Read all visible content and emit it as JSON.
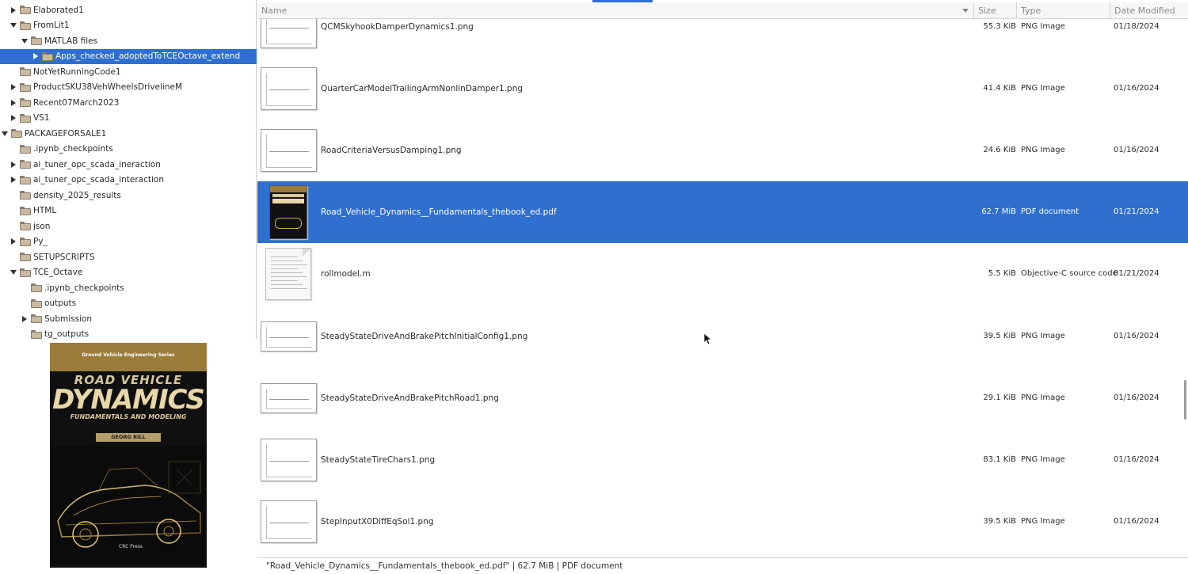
{
  "tree": {
    "items": [
      {
        "label": "Elaborated1",
        "level": 4,
        "toggle": "collapsed"
      },
      {
        "label": "FromLit1",
        "level": 4,
        "toggle": "expanded"
      },
      {
        "label": "MATLAB files",
        "level": 5,
        "toggle": "expanded"
      },
      {
        "label": "Apps_checked_adoptedToTCEOctave_extend",
        "level": 6,
        "toggle": "collapsed",
        "selected": true
      },
      {
        "label": "NotYetRunningCode1",
        "level": 4,
        "toggle": "none"
      },
      {
        "label": "ProductSKU38VehWheelsDrivelineM",
        "level": 4,
        "toggle": "collapsed"
      },
      {
        "label": "Recent07March2023",
        "level": 4,
        "toggle": "collapsed"
      },
      {
        "label": "VS1",
        "level": 4,
        "toggle": "collapsed"
      },
      {
        "label": "PACKAGEFORSALE1",
        "level": 3,
        "toggle": "expanded"
      },
      {
        "label": ".ipynb_checkpoints",
        "level": 4,
        "toggle": "none"
      },
      {
        "label": "ai_tuner_opc_scada_ineraction",
        "level": 4,
        "toggle": "collapsed"
      },
      {
        "label": "ai_tuner_opc_scada_interaction",
        "level": 4,
        "toggle": "collapsed"
      },
      {
        "label": "density_2025_results",
        "level": 4,
        "toggle": "none"
      },
      {
        "label": "HTML",
        "level": 4,
        "toggle": "none"
      },
      {
        "label": "json",
        "level": 4,
        "toggle": "none"
      },
      {
        "label": "Py_",
        "level": 4,
        "toggle": "collapsed"
      },
      {
        "label": "SETUPSCRIPTS",
        "level": 4,
        "toggle": "none"
      },
      {
        "label": "TCE_Octave",
        "level": 4,
        "toggle": "expanded"
      },
      {
        "label": ".ipynb_checkpoints",
        "level": 5,
        "toggle": "none"
      },
      {
        "label": "outputs",
        "level": 5,
        "toggle": "none"
      },
      {
        "label": "Submission",
        "level": 5,
        "toggle": "collapsed"
      },
      {
        "label": "tg_outputs",
        "level": 5,
        "toggle": "none"
      }
    ]
  },
  "preview": {
    "series": "Ground Vehicle Engineering Series",
    "title_line1": "ROAD VEHICLE",
    "title_line2": "DYNAMICS",
    "subtitle": "FUNDAMENTALS AND MODELING",
    "author": "GEORG RILL",
    "publisher": "CRC Press"
  },
  "columns": {
    "name": "Name",
    "size": "Size",
    "type": "Type",
    "date": "Date Modified"
  },
  "files": [
    {
      "name": "QCMSkyhookDamperDynamics1.png",
      "size": "55.3 KiB",
      "type": "PNG Image",
      "date": "01/18/2024",
      "thumb": "plot"
    },
    {
      "name": "QuarterCarModelTrailingArmNonlinDamper1.png",
      "size": "41.4 KiB",
      "type": "PNG Image",
      "date": "01/16/2024",
      "thumb": "plot"
    },
    {
      "name": "RoadCriteriaVersusDamping1.png",
      "size": "24.6 KiB",
      "type": "PNG Image",
      "date": "01/16/2024",
      "thumb": "plot"
    },
    {
      "name": "Road_Vehicle_Dynamics__Fundamentals_thebook_ed.pdf",
      "size": "62.7 MiB",
      "type": "PDF document",
      "date": "01/21/2024",
      "thumb": "book",
      "selected": true
    },
    {
      "name": "rollmodel.m",
      "size": "5.5 KiB",
      "type": "Objective-C source code",
      "date": "01/21/2024",
      "thumb": "doc"
    },
    {
      "name": "SteadyStateDriveAndBrakePitchInitialConfig1.png",
      "size": "39.5 KiB",
      "type": "PNG Image",
      "date": "01/16/2024",
      "thumb": "plot"
    },
    {
      "name": "SteadyStateDriveAndBrakePitchRoad1.png",
      "size": "29.1 KiB",
      "type": "PNG Image",
      "date": "01/16/2024",
      "thumb": "plot"
    },
    {
      "name": "SteadyStateTireChars1.png",
      "size": "83.1 KiB",
      "type": "PNG Image",
      "date": "01/16/2024",
      "thumb": "plot"
    },
    {
      "name": "StepInputX0DiffEqSol1.png",
      "size": "39.5 KiB",
      "type": "PNG Image",
      "date": "01/16/2024",
      "thumb": "plot"
    }
  ],
  "status": {
    "text": "\"Road_Vehicle_Dynamics__Fundamentals_thebook_ed.pdf\"  |  62.7 MiB  |  PDF document"
  },
  "colors": {
    "selection": "#2f6fd0",
    "folder": "#c9b9a3"
  }
}
